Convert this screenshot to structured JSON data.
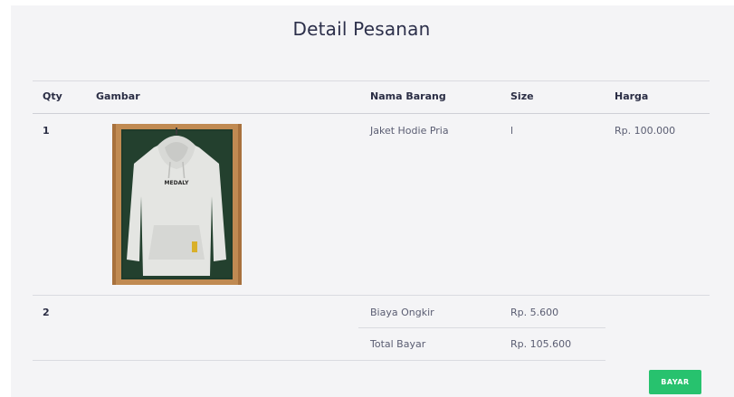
{
  "page": {
    "title": "Detail Pesanan"
  },
  "table": {
    "headers": {
      "qty": "Qty",
      "gambar": "Gambar",
      "nama_barang": "Nama Barang",
      "size": "Size",
      "harga": "Harga"
    },
    "item": {
      "qty": "1",
      "nama_barang": "Jaket Hodie Pria",
      "size": "l",
      "harga": "Rp. 100.000",
      "image_label": "MEDALY"
    },
    "shipping": {
      "qty": "2",
      "label": "Biaya Ongkir",
      "value": "Rp. 5.600"
    },
    "total": {
      "label": "Total Bayar",
      "value": "Rp. 105.600"
    }
  },
  "actions": {
    "bayar_label": "BAYAR"
  },
  "colors": {
    "accent_button": "#27c26e",
    "background": "#f4f4f6",
    "text_dark": "#2a2d44"
  }
}
